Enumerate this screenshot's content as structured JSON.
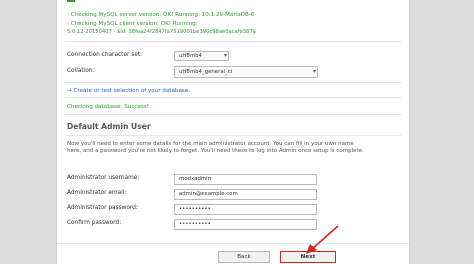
{
  "checks": {
    "server": "- Checking MySQL server version: OK! Running: 10.1.29-MariaDB-6",
    "client": "- Checking MySQL client version: OK! Running:",
    "client_version": "5.0.12-20150407 - $Id: 38fea24f2847fa7519001be390c98ae0acafe387$"
  },
  "charset": {
    "label": "Connection character set:",
    "value": "utf8mb4"
  },
  "collation": {
    "label": "Collation:",
    "value": "utf8mb4_general_ci"
  },
  "db_link": "→ Create or test selection of your database.",
  "db_status": "Checking database: Success!",
  "admin": {
    "heading": "Default Admin User",
    "intro": "Now you'll need to enter some details for the main administrator account. You can fill in your own name here, and a password you're not likely to forget. You'll need these to log into Admin once setup is complete.",
    "username_label": "Administrator username:",
    "username_value": "modxadmin",
    "email_label": "Administrator email:",
    "email_value": "admin@example.com",
    "password_label": "Administrator password:",
    "password_value": "••••••••••",
    "confirm_label": "Confirm password:",
    "confirm_value": "••••••••••"
  },
  "buttons": {
    "back": "Back",
    "next": "Next"
  },
  "colors": {
    "success": "#2f9a2f",
    "link": "#2a64b0",
    "highlight": "#d42525"
  }
}
